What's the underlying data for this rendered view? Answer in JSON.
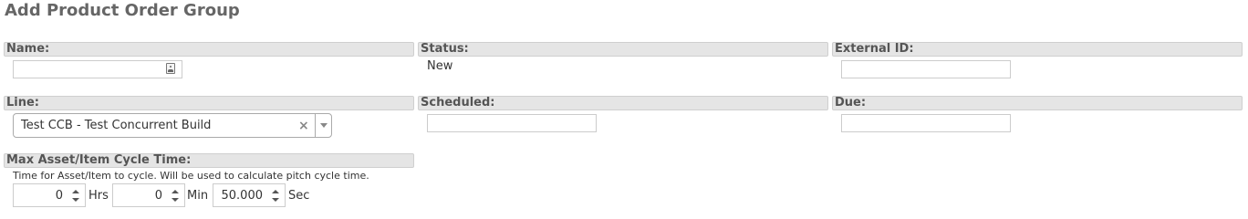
{
  "page": {
    "title": "Add Product Order Group"
  },
  "fields": {
    "name": {
      "label": "Name:",
      "value": ""
    },
    "status": {
      "label": "Status:",
      "value": "New"
    },
    "external_id": {
      "label": "External ID:",
      "value": ""
    },
    "line": {
      "label": "Line:",
      "selected": "Test CCB - Test Concurrent Build"
    },
    "scheduled": {
      "label": "Scheduled:",
      "value": ""
    },
    "due": {
      "label": "Due:",
      "value": ""
    },
    "cycle_time": {
      "label": "Max Asset/Item Cycle Time:",
      "help": "Time for Asset/Item to cycle. Will be used to calculate pitch cycle time.",
      "hours": {
        "value": "0",
        "unit": "Hrs"
      },
      "minutes": {
        "value": "0",
        "unit": "Min"
      },
      "seconds": {
        "value": "50.000",
        "unit": "Sec"
      }
    }
  },
  "icons": {
    "name_input": "contact-card-icon",
    "clear": "clear-x-icon",
    "dropdown": "chevron-down-icon",
    "spin_up": "spin-up-icon",
    "spin_down": "spin-down-icon"
  },
  "colors": {
    "label_bar_bg": "#e5e5e5",
    "label_bar_border": "#cfcfcf",
    "title_text": "#666666"
  }
}
